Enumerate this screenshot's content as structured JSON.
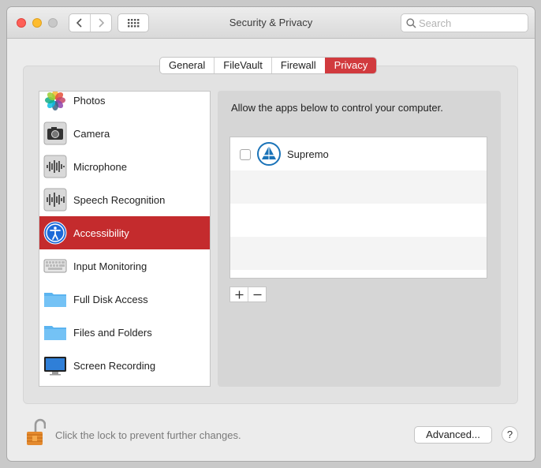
{
  "window": {
    "title": "Security & Privacy"
  },
  "search": {
    "placeholder": "Search"
  },
  "tabs": [
    {
      "label": "General",
      "active": false
    },
    {
      "label": "FileVault",
      "active": false
    },
    {
      "label": "Firewall",
      "active": false
    },
    {
      "label": "Privacy",
      "active": true
    }
  ],
  "sidebar": {
    "items": [
      {
        "label": "Photos",
        "icon": "photos-icon"
      },
      {
        "label": "Camera",
        "icon": "camera-icon"
      },
      {
        "label": "Microphone",
        "icon": "microphone-icon"
      },
      {
        "label": "Speech Recognition",
        "icon": "speech-recognition-icon"
      },
      {
        "label": "Accessibility",
        "icon": "accessibility-icon",
        "selected": true
      },
      {
        "label": "Input Monitoring",
        "icon": "keyboard-icon"
      },
      {
        "label": "Full Disk Access",
        "icon": "folder-icon"
      },
      {
        "label": "Files and Folders",
        "icon": "folder-icon"
      },
      {
        "label": "Screen Recording",
        "icon": "display-icon"
      }
    ]
  },
  "content": {
    "description": "Allow the apps below to control your computer.",
    "apps": [
      {
        "name": "Supremo",
        "checked": false,
        "icon": "supremo-icon"
      }
    ]
  },
  "footer": {
    "lock_text": "Click the lock to prevent further changes.",
    "advanced_label": "Advanced...",
    "help_label": "?"
  },
  "colors": {
    "accent": "#c42b2d",
    "tab_active": "#d13a3e"
  }
}
